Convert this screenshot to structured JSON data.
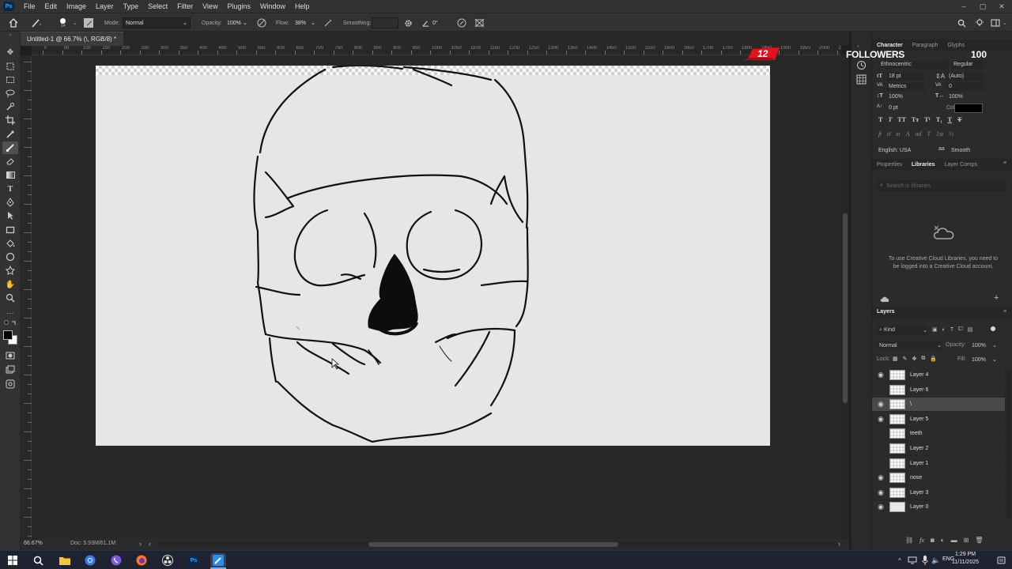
{
  "app": {
    "logo": "Ps"
  },
  "menu": {
    "items": [
      "File",
      "Edit",
      "Image",
      "Layer",
      "Type",
      "Select",
      "Filter",
      "View",
      "Plugins",
      "Window",
      "Help"
    ]
  },
  "options": {
    "brush_size": "14",
    "mode_label": "Mode:",
    "mode_value": "Normal",
    "opacity_label": "Opacity:",
    "opacity_value": "100%",
    "flow_label": "Flow:",
    "flow_value": "38%",
    "smoothing_label": "Smoothing:",
    "smoothing_value": "",
    "angle_value": "0°"
  },
  "document": {
    "tab_title": "Untitled-1 @ 66.7% (\\, RGB/8) *"
  },
  "ruler": {
    "ticks": [
      "0",
      "50",
      "100",
      "150",
      "200",
      "250",
      "300",
      "350",
      "400",
      "450",
      "500",
      "550",
      "600",
      "650",
      "700",
      "750",
      "800",
      "850",
      "900",
      "950",
      "1000",
      "1050",
      "1100",
      "1150",
      "1200",
      "1250",
      "1300",
      "1350",
      "1400",
      "1450",
      "1500",
      "1550",
      "1600",
      "1650",
      "1700",
      "1750",
      "1800",
      "1850",
      "1900",
      "1950",
      "2000",
      "2050",
      "2100",
      "2150"
    ]
  },
  "status": {
    "zoom": "66.67%",
    "doc": "Doc: 5.93M/61.1M"
  },
  "overlay": {
    "badge": "12",
    "label": "FOLLOWERS",
    "count": "100"
  },
  "character": {
    "tabs": [
      "Character",
      "Paragraph",
      "Glyphs"
    ],
    "font_family": "Ethnocentric",
    "font_style": "Regular",
    "size": "18 pt",
    "leading": "(Auto)",
    "kerning": "Metrics",
    "tracking": "0",
    "vscale": "100%",
    "hscale": "100%",
    "baseline": "0 pt",
    "color_label": "Color:",
    "language": "English: USA",
    "aa_icon": "aa",
    "antialias": "Smooth"
  },
  "libraries": {
    "tabs": [
      "Properties",
      "Libraries",
      "Layer Comps"
    ],
    "search_placeholder": "Search in libraries",
    "message": "To use Creative Cloud Libraries, you need to be logged into a Creative Cloud account."
  },
  "layers": {
    "title": "Layers",
    "kind_label": "Kind",
    "blend_mode": "Normal",
    "opacity_label": "Opacity:",
    "opacity_value": "100%",
    "lock_label": "Lock:",
    "fill_label": "Fill:",
    "fill_value": "100%",
    "items": [
      {
        "name": "Layer 4",
        "visible": true,
        "selected": false
      },
      {
        "name": "Layer 6",
        "visible": false,
        "selected": false
      },
      {
        "name": "\\",
        "visible": true,
        "selected": true
      },
      {
        "name": "Layer 5",
        "visible": true,
        "selected": false
      },
      {
        "name": "teeth",
        "visible": false,
        "selected": false
      },
      {
        "name": "Layer 2",
        "visible": false,
        "selected": false
      },
      {
        "name": "Layer 1",
        "visible": false,
        "selected": false
      },
      {
        "name": "nose",
        "visible": true,
        "selected": false
      },
      {
        "name": "Layer 3",
        "visible": true,
        "selected": false
      },
      {
        "name": "Layer 0",
        "visible": true,
        "selected": false
      }
    ]
  },
  "taskbar": {
    "lang": "ENG",
    "time": "1:29 PM",
    "date": "11/11/2025"
  }
}
